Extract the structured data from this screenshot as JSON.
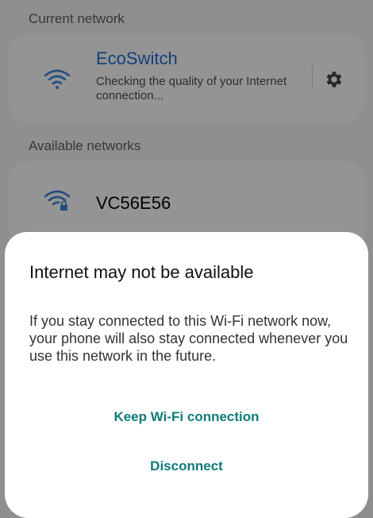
{
  "current_section": {
    "label": "Current network",
    "network": {
      "name": "EcoSwitch",
      "status": "Checking the quality of your Internet connection...",
      "icon": "wifi-icon",
      "settings_icon": "gear-icon"
    }
  },
  "available_section": {
    "label": "Available networks",
    "networks": [
      {
        "name": "VC56E56",
        "icon": "wifi-lock-icon"
      }
    ]
  },
  "dialog": {
    "title": "Internet may not be available",
    "body": "If you stay connected to this Wi-Fi network now, your phone will also stay connected whenever you use this network in the future.",
    "keep_label": "Keep Wi-Fi connection",
    "disconnect_label": "Disconnect"
  },
  "colors": {
    "accent": "#0e7b7b",
    "network_name": "#1c6fd6"
  }
}
